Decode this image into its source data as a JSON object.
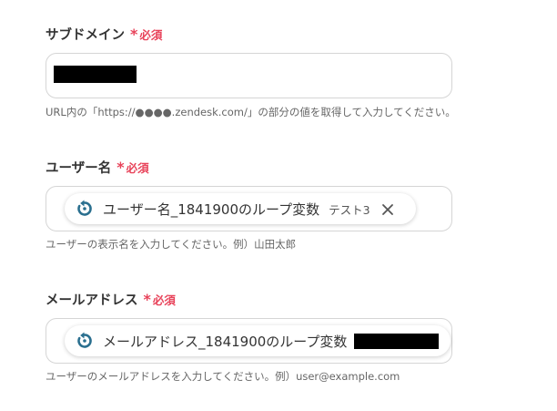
{
  "fields": [
    {
      "label": "サブドメイン",
      "required_mark": "*",
      "required_text": "必須",
      "help": "URL内の「https://●●●●.zendesk.com/」の部分の値を取得して入力してください。"
    },
    {
      "label": "ユーザー名",
      "required_mark": "*",
      "required_text": "必須",
      "chip_label": "ユーザー名_1841900のループ変数",
      "chip_value": "テスト3",
      "help": "ユーザーの表示名を入力してください。例）山田太郎"
    },
    {
      "label": "メールアドレス",
      "required_mark": "*",
      "required_text": "必須",
      "chip_label": "メールアドレス_1841900のループ変数",
      "help": "ユーザーのメールアドレスを入力してください。例）user@example.com"
    }
  ],
  "colors": {
    "required": "#e8435a",
    "loop_icon": "#2a6f8f",
    "redacted": "#000000"
  },
  "icons": {
    "loop": "loop-arrow-icon",
    "close": "close-icon"
  }
}
